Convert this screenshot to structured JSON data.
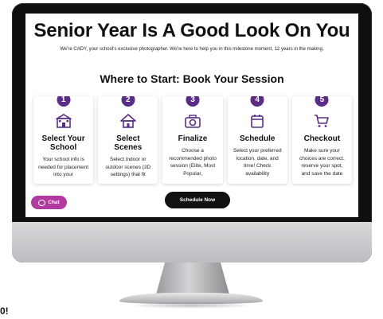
{
  "page": {
    "headline": "Senior Year Is A Good Look On You",
    "subline": "We're CADY, your school's exclusive photographer. We're here to help you in this milestone moment, 12 years in the making.",
    "section_title": "Where to Start: Book Your Session"
  },
  "steps": [
    {
      "number": "1",
      "icon": "school-building-icon",
      "title": "Select Your School",
      "text": "Your school info is needed for placement into your"
    },
    {
      "number": "2",
      "icon": "home-icon",
      "title": "Select Scenes",
      "text": "Select indoor or outdoor scenes (3D settings) that fit"
    },
    {
      "number": "3",
      "icon": "camera-icon",
      "title": "Finalize",
      "text": "Choose a recommended photo session (Elite, Most Popular,"
    },
    {
      "number": "4",
      "icon": "calendar-icon",
      "title": "Schedule",
      "text": "Select your preferred location, date, and time! Check availability"
    },
    {
      "number": "5",
      "icon": "cart-icon",
      "title": "Checkout",
      "text": "Make sure your choices are correct, reserve your spot, and save the date"
    }
  ],
  "buttons": {
    "chat_label": "Chat",
    "schedule_label": "Schedule Now"
  },
  "colors": {
    "accent_purple": "#5b2c86",
    "chat_magenta": "#b13aa0",
    "button_dark": "#111111"
  },
  "edge_text": "0!"
}
